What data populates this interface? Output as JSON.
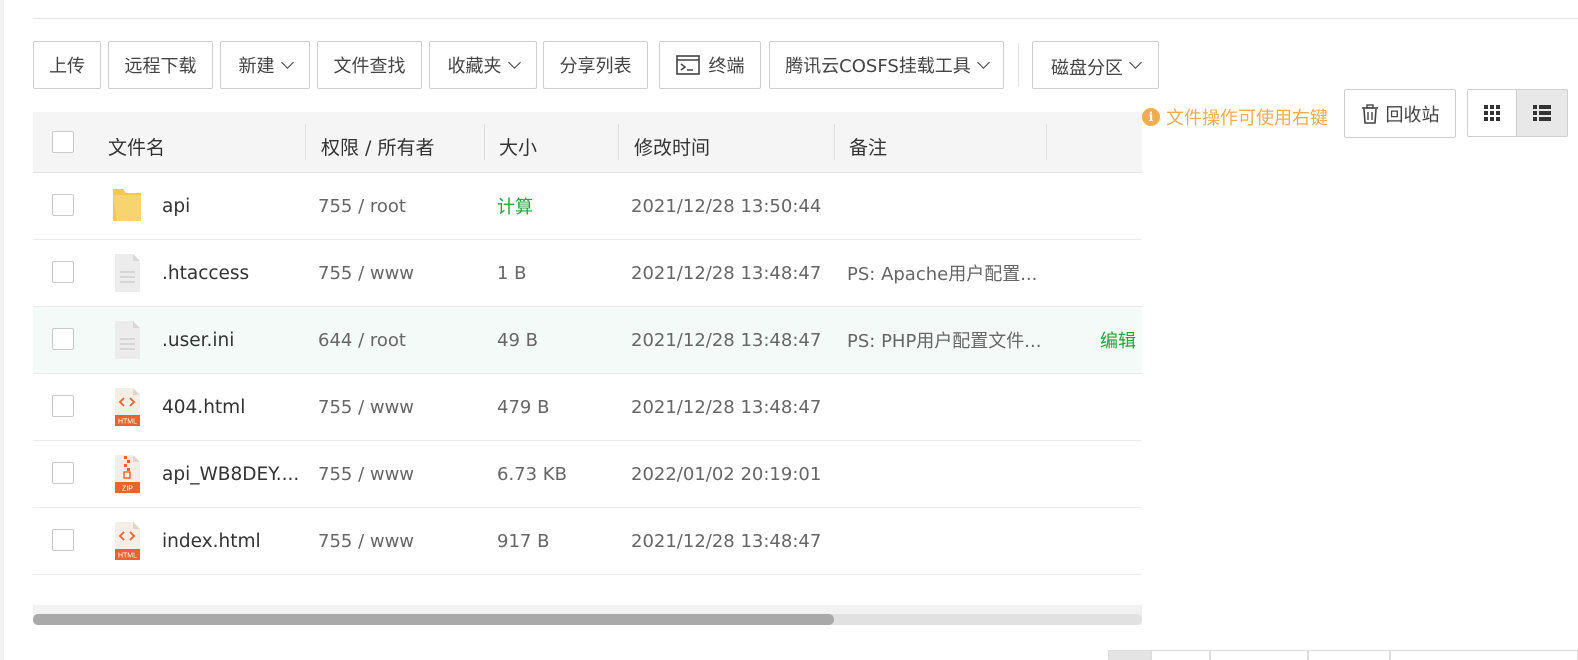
{
  "toolbar": {
    "upload": "上传",
    "remote_download": "远程下载",
    "new": "新建",
    "file_search": "文件查找",
    "favorites": "收藏夹",
    "share_list": "分享列表",
    "terminal": "终端",
    "cosfs_tool": "腾讯云COSFS挂载工具",
    "disk_partition": "磁盘分区"
  },
  "tip": "文件操作可使用右键",
  "recycle_bin": "回收站",
  "columns": {
    "name": "文件名",
    "permission": "权限 / 所有者",
    "size": "大小",
    "modified": "修改时间",
    "note": "备注"
  },
  "rows": [
    {
      "name": "api",
      "perm": "755 / root",
      "size": "计算",
      "time": "2021/12/28 13:50:44",
      "note": "",
      "type": "folder"
    },
    {
      "name": ".htaccess",
      "perm": "755 / www",
      "size": "1 B",
      "time": "2021/12/28 13:48:47",
      "note": "PS: Apache用户配置...",
      "type": "text"
    },
    {
      "name": ".user.ini",
      "perm": "644 / root",
      "size": "49 B",
      "time": "2021/12/28 13:48:47",
      "note": "PS: PHP用户配置文件...",
      "type": "text",
      "action": "编辑"
    },
    {
      "name": "404.html",
      "perm": "755 / www",
      "size": "479 B",
      "time": "2021/12/28 13:48:47",
      "note": "",
      "type": "html"
    },
    {
      "name": "api_WB8DEY....",
      "perm": "755 / www",
      "size": "6.73 KB",
      "time": "2022/01/02 20:19:01",
      "note": "",
      "type": "zip"
    },
    {
      "name": "index.html",
      "perm": "755 / www",
      "size": "917 B",
      "time": "2021/12/28 13:48:47",
      "note": "",
      "type": "html"
    }
  ],
  "icon_labels": {
    "html": "HTML",
    "zip": "ZIP"
  },
  "colors": {
    "accent_green": "#20a53a",
    "tip_orange": "#f0ad4e",
    "folder": "#f7d56e"
  }
}
